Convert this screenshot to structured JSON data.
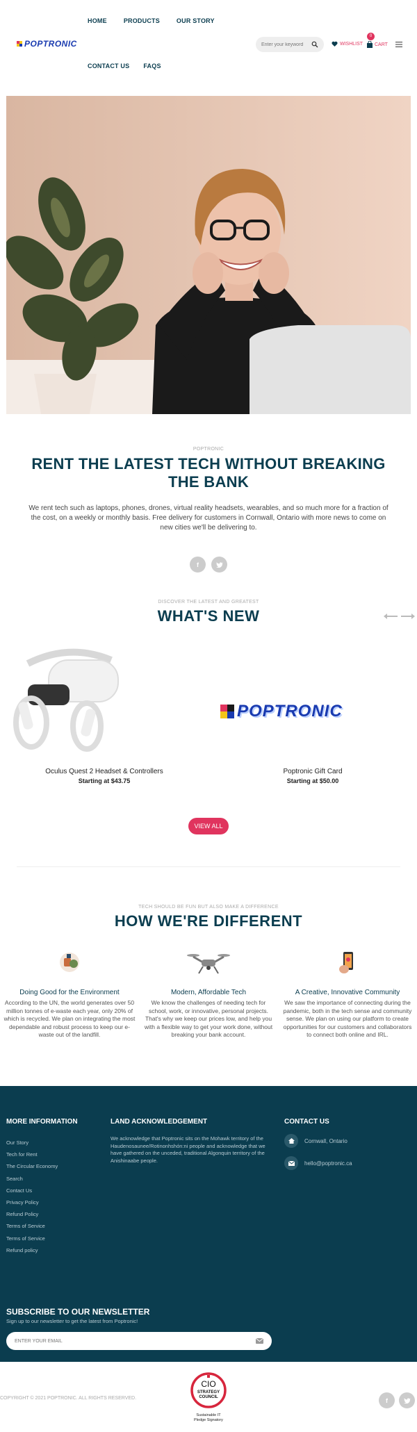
{
  "header": {
    "nav_top": [
      "HOME",
      "PRODUCTS",
      "OUR STORY"
    ],
    "nav_bottom": [
      "CONTACT US",
      "FAQS"
    ],
    "logo_text": "POPTRONIC",
    "search_placeholder": "Enter your keyword",
    "wishlist_label": "WISHLIST",
    "cart_label": "CART",
    "cart_count": "0"
  },
  "intro": {
    "eyebrow": "POPTRONIC",
    "title": "RENT THE LATEST TECH WITHOUT BREAKING THE BANK",
    "text": "We rent tech such as laptops, phones, drones, virtual reality headsets, wearables, and so much more for a fraction of the cost, on a weekly or monthly basis. Free delivery for customers in Cornwall, Ontario with more news to come on new cities we'll be delivering to.",
    "social": [
      "f",
      "t"
    ]
  },
  "whats_new": {
    "eyebrow": "DISCOVER THE LATEST AND GREATEST",
    "title": "WHAT'S NEW",
    "products": [
      {
        "name": "Oculus Quest 2 Headset & Controllers",
        "price": "Starting at $43.75"
      },
      {
        "name": "Poptronic Gift Card",
        "price": "Starting at $50.00",
        "logo_text": "POPTRONIC"
      }
    ],
    "view_all": "VIEW ALL"
  },
  "different": {
    "eyebrow": "TECH SHOULD BE FUN BUT ALSO MAKE A DIFFERENCE",
    "title": "HOW WE'RE DIFFERENT",
    "features": [
      {
        "title": "Doing Good for the Environment",
        "text": "According to the UN, the world generates over 50 million tonnes of e-waste each year, only 20% of which is recycled. We plan on integrating the most dependable and robust process to keep our e-waste out of the landfill."
      },
      {
        "title": "Modern, Affordable Tech",
        "text": "We know the challenges of needing tech for school, work, or innovative, personal projects. That's why we keep our prices low, and help you with a flexible way to get your work done, without breaking your bank account."
      },
      {
        "title": "A Creative, Innovative Community",
        "text": "We saw the importance of connecting during the pandemic, both in the tech sense and community sense. We plan on using our platform to create opportunities for our customers and collaborators to connect both online and IRL."
      }
    ]
  },
  "footer": {
    "more_info_title": "MORE INFORMATION",
    "links": [
      "Our Story",
      "Tech for Rent",
      "The Circular Economy",
      "Search",
      "Contact Us",
      "Privacy Policy",
      "Refund Policy",
      "Terms of Service",
      "Terms of Service",
      "Refund policy"
    ],
    "land_title": "LAND ACKNOWLEDGEMENT",
    "land_text": "We acknowledge that Poptronic sits on the Mohawk territory of the Haudenosaunee/Rotinonhshón:ni people and acknowledge that we have gathered on the unceded, traditional Algonquin territory of the Anishinaabe people.",
    "contact_title": "CONTACT US",
    "location": "Cornwall, Ontario",
    "email": "hello@poptronic.ca",
    "newsletter_title": "SUBSCRIBE TO OUR NEWSLETTER",
    "newsletter_sub": "Sign up to our newsletter to get the latest from Poptronic!",
    "newsletter_placeholder": "ENTER YOUR EMAIL"
  },
  "bottom": {
    "copyright": "COPYRIGHT © 2021 POPTRONIC. ALL RIGHTS RESERVED.",
    "cio_caption_1": "Sustainable IT",
    "cio_caption_2": "Pledge Signatory",
    "cio_seal": [
      "CIO",
      "STRATEGY",
      "COUNCIL"
    ]
  },
  "colors": {
    "accent": "#e0345e",
    "navy": "#0b3d4f"
  }
}
